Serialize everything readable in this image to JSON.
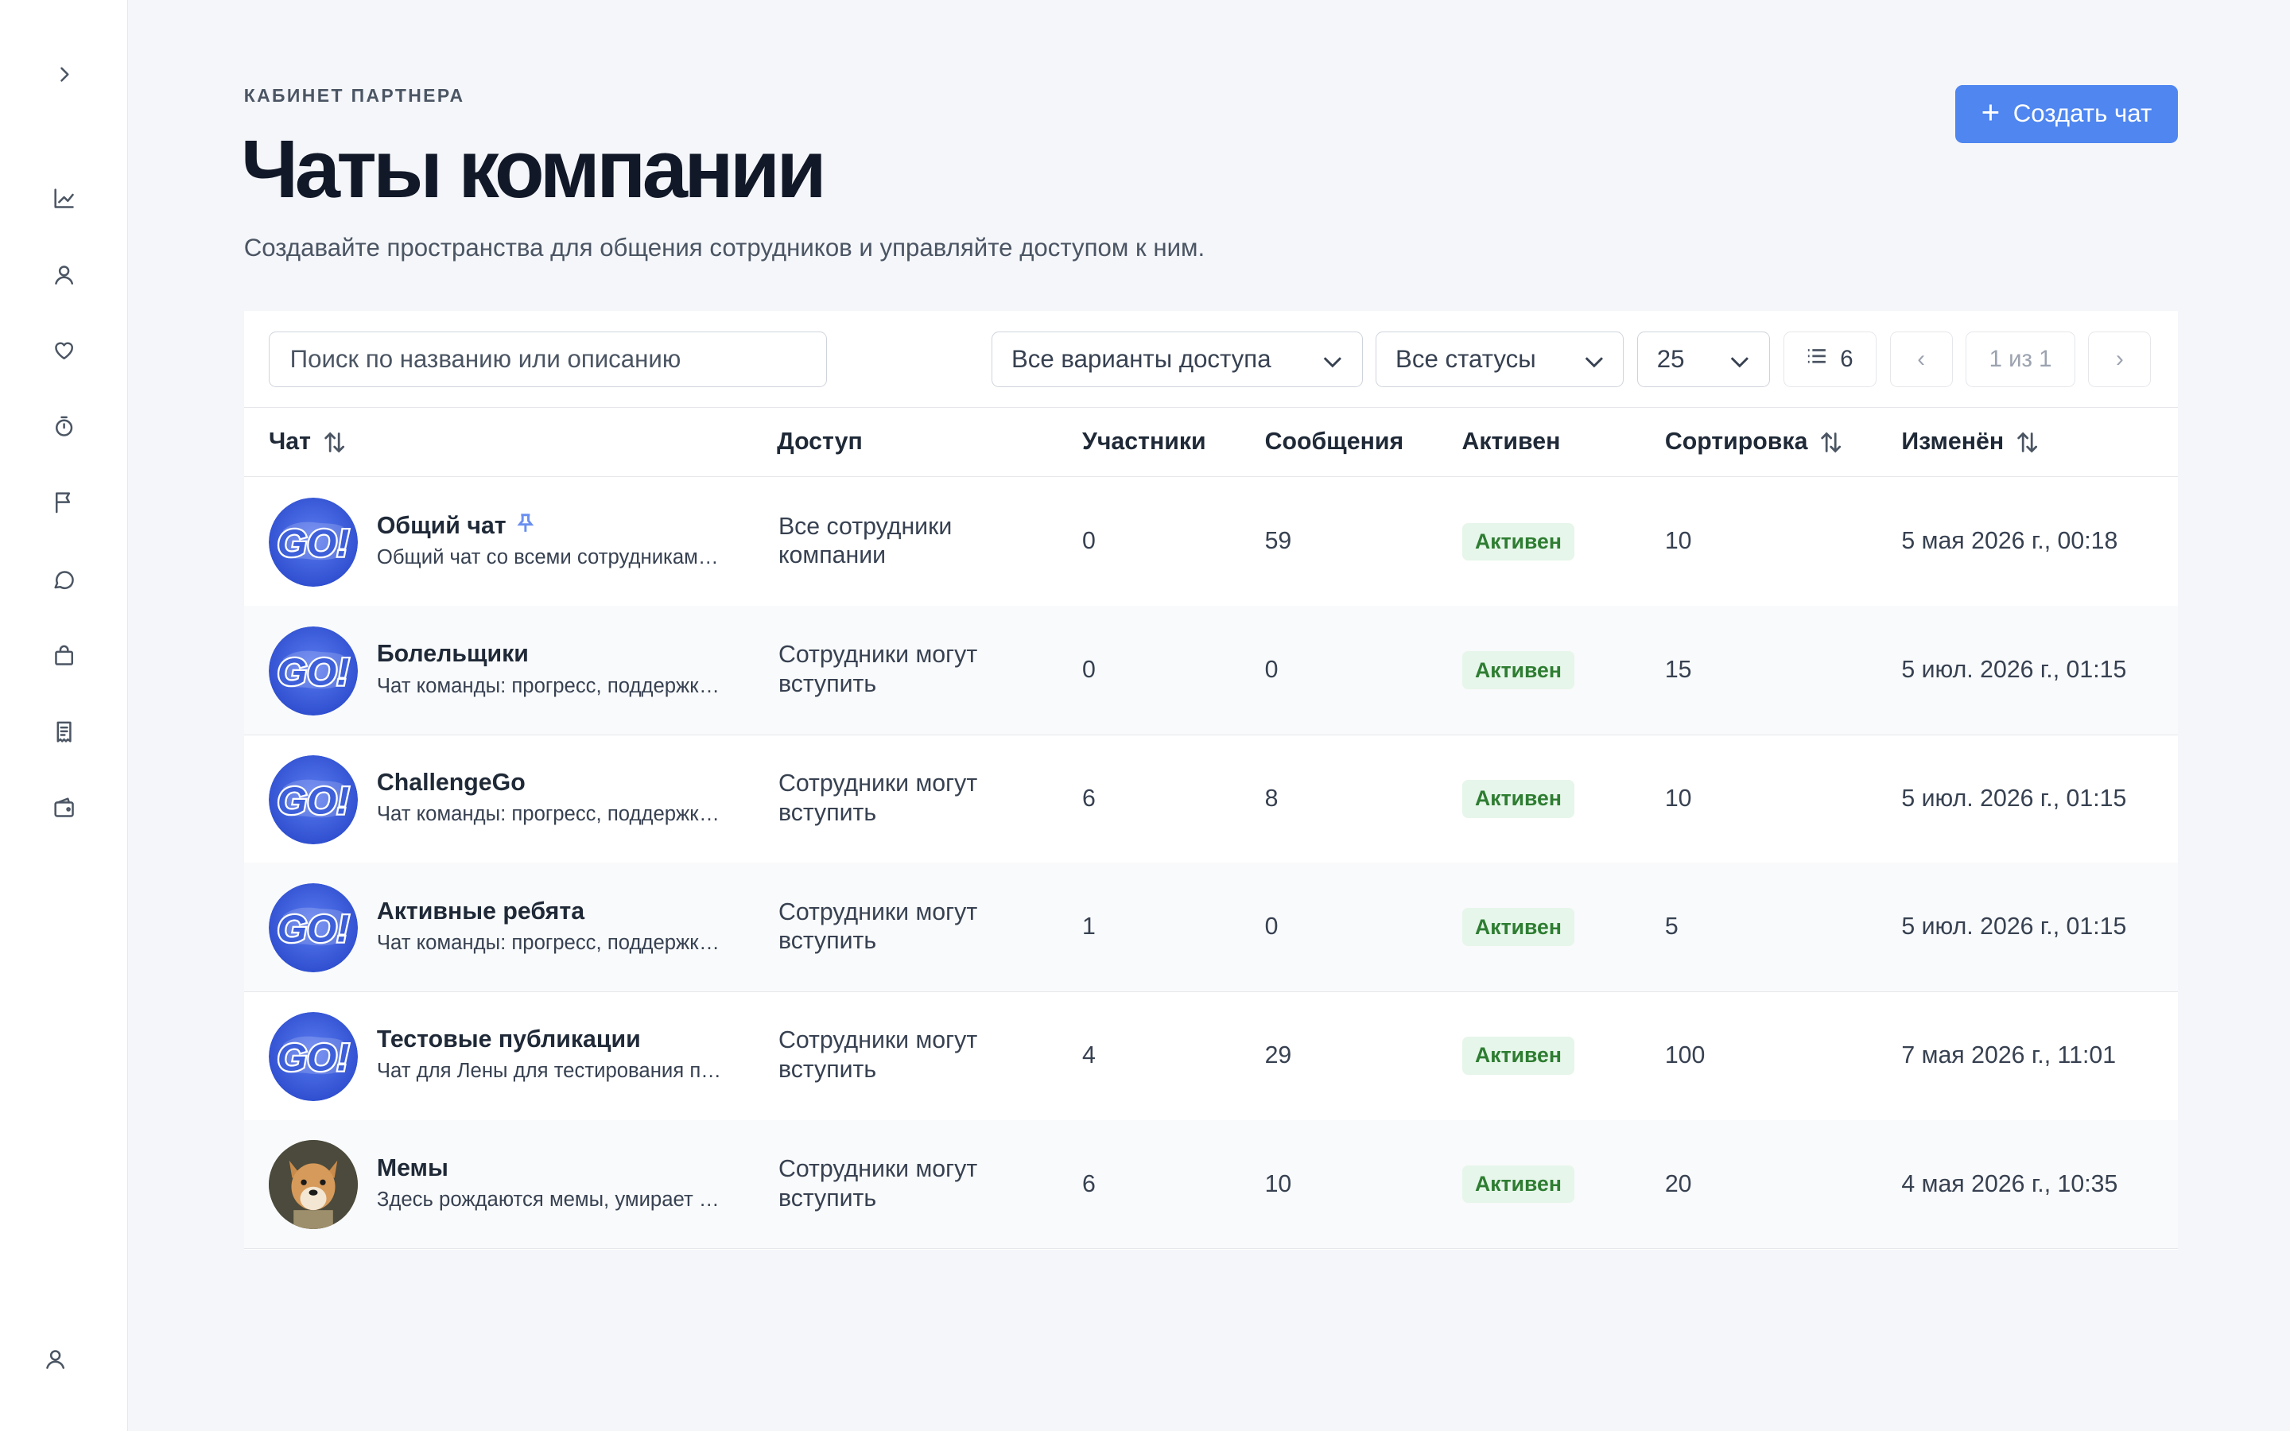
{
  "sidebar": {
    "icons": [
      "chevron-right-icon",
      "chart-icon",
      "user-icon",
      "heart-icon",
      "timer-icon",
      "flag-icon",
      "chat-icon",
      "bag-icon",
      "receipt-icon",
      "wallet-icon",
      "profile-icon"
    ]
  },
  "header": {
    "eyebrow": "КАБИНЕТ ПАРТНЕРА",
    "title": "Чаты компании",
    "subtitle": "Создавайте пространства для общения сотрудников и управляйте доступом к ним.",
    "create_label": "Создать чат",
    "create_icon": "+"
  },
  "toolbar": {
    "search_placeholder": "Поиск по названию или описанию",
    "access_filter": "Все варианты доступа",
    "status_filter": "Все статусы",
    "page_size": "25",
    "total_count": "6",
    "prev": "‹",
    "page_info": "1 из 1",
    "next": "›"
  },
  "table": {
    "columns": {
      "chat": "Чат",
      "access": "Доступ",
      "members": "Участники",
      "messages": "Сообщения",
      "active": "Активен",
      "sort": "Сортировка",
      "changed": "Изменён"
    },
    "rows": [
      {
        "name": "Общий чат",
        "pinned": true,
        "desc": "Общий чат со всеми сотрудниками компании",
        "access": "Все сотрудники компании",
        "members": "0",
        "messages": "59",
        "status": "Активен",
        "sort": "10",
        "changed": "5 мая 2026 г., 00:18",
        "avatar": "go-logo"
      },
      {
        "name": "Болельщики",
        "pinned": false,
        "desc": "Чат команды: прогресс, поддержка и общение",
        "access": "Сотрудники могут вступить",
        "members": "0",
        "messages": "0",
        "status": "Активен",
        "sort": "15",
        "changed": "5 июл. 2026 г., 01:15",
        "avatar": "go-logo"
      },
      {
        "name": "ChallengeGo",
        "pinned": false,
        "desc": "Чат команды: прогресс, поддержка и общение",
        "access": "Сотрудники могут вступить",
        "members": "6",
        "messages": "8",
        "status": "Активен",
        "sort": "10",
        "changed": "5 июл. 2026 г., 01:15",
        "avatar": "go-logo"
      },
      {
        "name": "Активные ребята",
        "pinned": false,
        "desc": "Чат команды: прогресс, поддержка и общение",
        "access": "Сотрудники могут вступить",
        "members": "1",
        "messages": "0",
        "status": "Активен",
        "sort": "5",
        "changed": "5 июл. 2026 г., 01:15",
        "avatar": "go-logo"
      },
      {
        "name": "Тестовые публикации",
        "pinned": false,
        "desc": "Чат для Лены для тестирования публикаций",
        "access": "Сотрудники могут вступить",
        "members": "4",
        "messages": "29",
        "status": "Активен",
        "sort": "100",
        "changed": "7 мая 2026 г., 11:01",
        "avatar": "go-logo"
      },
      {
        "name": "Мемы",
        "pinned": false,
        "desc": "Здесь рождаются мемы, умирает скука",
        "access": "Сотрудники могут вступить",
        "members": "6",
        "messages": "10",
        "status": "Активен",
        "sort": "20",
        "changed": "4 мая 2026 г., 10:35",
        "avatar": "dog-photo"
      }
    ]
  },
  "colors": {
    "accent": "#4f86f0",
    "status_bg": "#e6f6ea",
    "status_text": "#2e7d32",
    "avatar_blue": "#3d5fd9"
  },
  "avatar_text": "GO!"
}
